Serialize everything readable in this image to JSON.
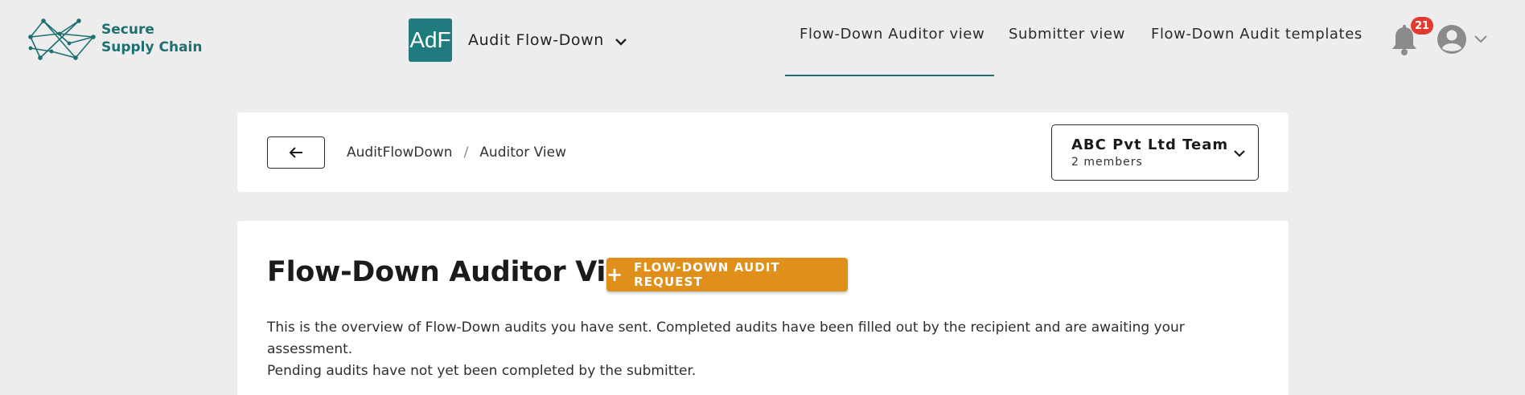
{
  "brand": {
    "line1": "Secure",
    "line2": "Supply Chain",
    "icon": "network-logo-icon",
    "color": "#1e6f70"
  },
  "app": {
    "badge": "AdF",
    "name": "Audit Flow-Down",
    "badge_color": "#1f7b7d"
  },
  "nav": {
    "items": [
      {
        "label": "Flow-Down Auditor view",
        "active": true
      },
      {
        "label": "Submitter view",
        "active": false
      },
      {
        "label": "Flow-Down Audit templates",
        "active": false
      }
    ]
  },
  "notifications": {
    "count": "21",
    "icon": "bell-icon"
  },
  "user_menu": {
    "icon": "user-avatar-icon"
  },
  "breadcrumb": {
    "items": [
      "AuditFlowDown",
      "Auditor View"
    ],
    "separator": "/"
  },
  "team": {
    "name": "ABC Pvt Ltd Team",
    "members": "2 members"
  },
  "page": {
    "title": "Flow-Down Auditor View",
    "request_button": "FLOW-DOWN AUDIT REQUEST",
    "request_button_color": "#e0901a",
    "description_line1": "This is the overview of Flow-Down audits you have sent. Completed audits have been filled out by the recipient and are awaiting your assessment.",
    "description_line2": "Pending audits have not yet been completed by the submitter."
  }
}
